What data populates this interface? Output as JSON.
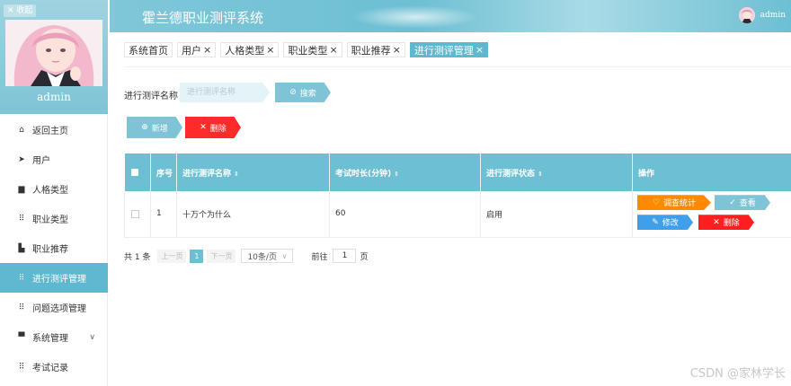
{
  "app": {
    "title": "霍兰德职业测评系统"
  },
  "header": {
    "user_name": "admin"
  },
  "sidebar": {
    "collapse_label": "收起",
    "admin_name": "admin",
    "items": [
      {
        "label": "返回主页",
        "icon": "home-icon"
      },
      {
        "label": "用户",
        "icon": "send-icon"
      },
      {
        "label": "人格类型",
        "icon": "doc-icon"
      },
      {
        "label": "职业类型",
        "icon": "grid-icon"
      },
      {
        "label": "职业推荐",
        "icon": "thumb-icon"
      },
      {
        "label": "进行测评管理",
        "icon": "grid-icon",
        "active": true
      },
      {
        "label": "问题选项管理",
        "icon": "grid-icon"
      },
      {
        "label": "系统管理",
        "icon": "chat-icon"
      },
      {
        "label": "考试记录",
        "icon": "grid-icon"
      }
    ]
  },
  "tabs": [
    {
      "label": "系统首页",
      "closable": false
    },
    {
      "label": "用户",
      "closable": true
    },
    {
      "label": "人格类型",
      "closable": true
    },
    {
      "label": "职业类型",
      "closable": true
    },
    {
      "label": "职业推荐",
      "closable": true
    },
    {
      "label": "进行测评管理",
      "closable": true,
      "active": true
    }
  ],
  "search": {
    "label": "进行测评名称",
    "placeholder": "进行测评名称",
    "button_label": "搜索"
  },
  "actions": {
    "add_label": "新增",
    "delete_label": "删除"
  },
  "table": {
    "columns": [
      "序号",
      "进行测评名称",
      "考试时长(分钟)",
      "进行测评状态",
      "操作"
    ],
    "rows": [
      {
        "index": "1",
        "name": "十万个为什么",
        "duration": "60",
        "status": "启用"
      }
    ],
    "ops": {
      "stat": "调查统计",
      "view": "查看",
      "edit": "修改",
      "delete": "删除"
    }
  },
  "pager": {
    "total": "共 1 条",
    "prev": "上一页",
    "current": "1",
    "next": "下一页",
    "page_size": "10条/页",
    "goto_label": "前往",
    "goto_value": "1",
    "page_unit": "页"
  },
  "watermark": "CSDN @家林学长",
  "colors": {
    "accent": "#6dbfd3",
    "danger": "#ff2b2b",
    "warning": "#ff8a00",
    "primary": "#3f9fe8"
  }
}
